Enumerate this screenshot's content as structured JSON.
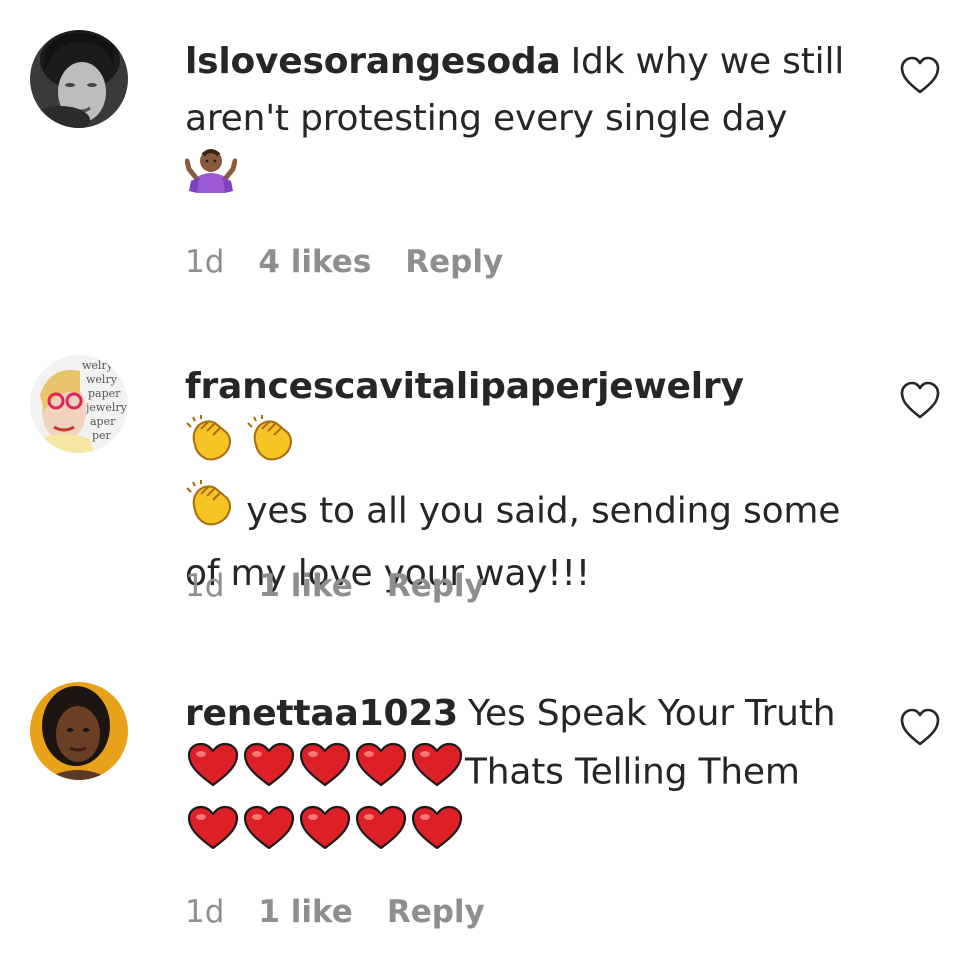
{
  "comments": [
    {
      "username": "lslovesorangesoda",
      "text": "Idk why we still aren't protesting every single day",
      "emoji": "shrug-emoji",
      "time": "1d",
      "likes": "4 likes",
      "reply": "Reply"
    },
    {
      "username": "francescavitalipaperjewelry",
      "text": "yes to all you said, sending some of my love your way!!!",
      "emoji": "clap-emoji",
      "time": "1d",
      "likes": "1 like",
      "reply": "Reply"
    },
    {
      "username": "renettaa1023",
      "text_1": "Yes Speak Your Truth",
      "text_2": "Thats Telling Them",
      "emoji": "red-heart-emoji",
      "time": "1d",
      "likes": "1 like",
      "reply": "Reply"
    }
  ],
  "colors": {
    "text": "#262626",
    "meta": "#8e8e8e",
    "heart_red": "#dd1f26",
    "clap_yellow": "#f7c325"
  }
}
